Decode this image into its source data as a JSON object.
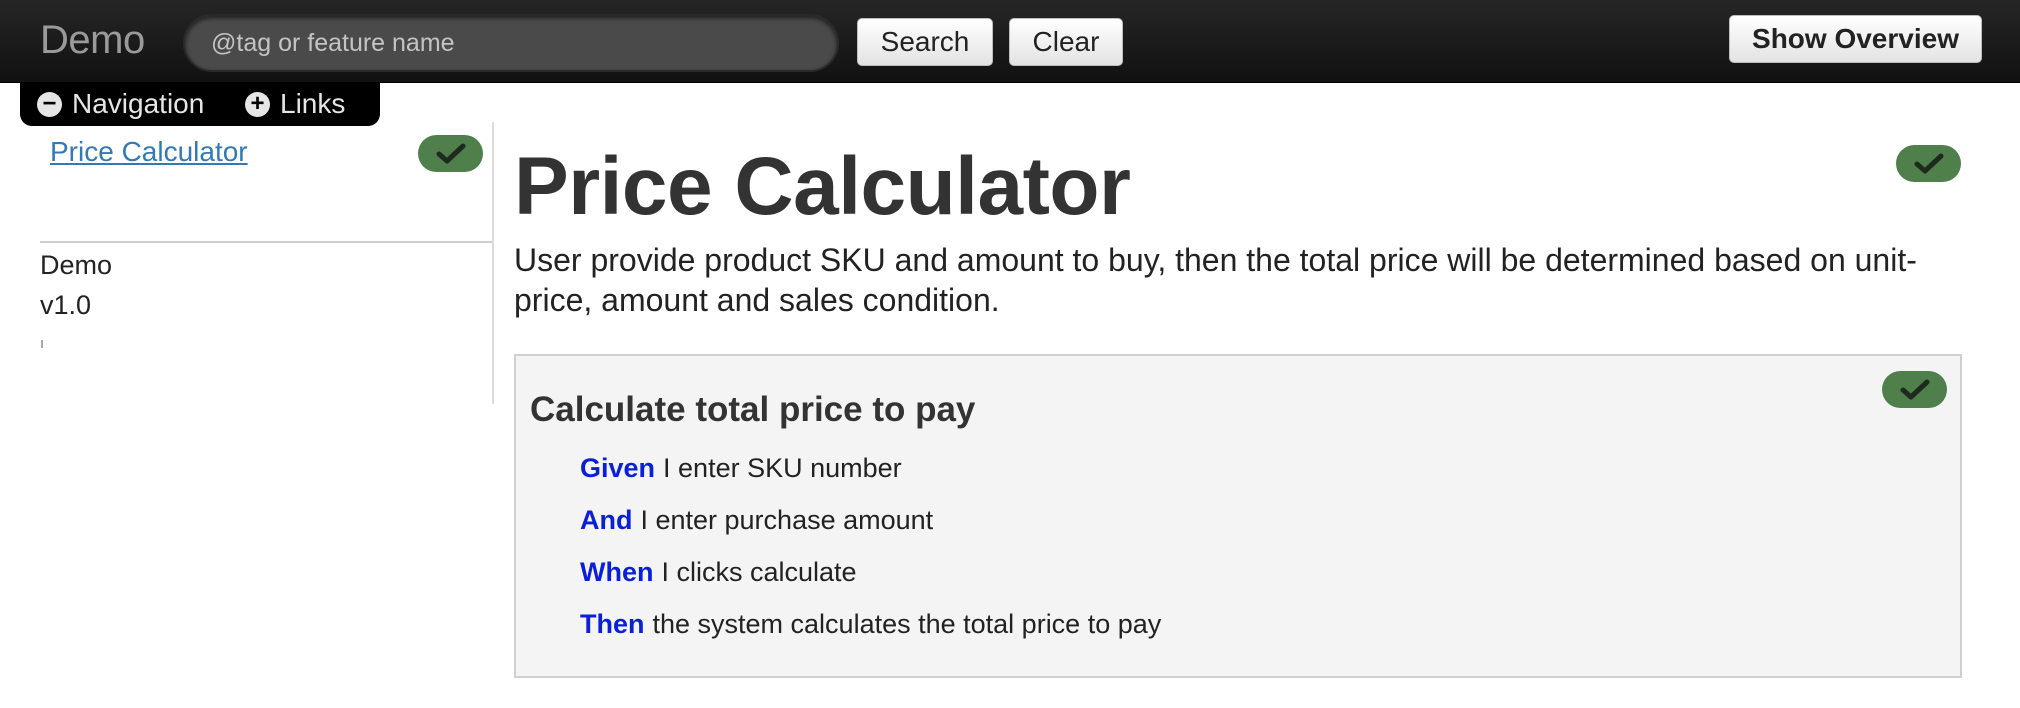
{
  "navbar": {
    "brand": "Demo",
    "search_placeholder": "@tag or feature name",
    "search_button": "Search",
    "clear_button": "Clear",
    "overview_button": "Show Overview"
  },
  "tabs": {
    "navigation": {
      "symbol": "−",
      "label": "Navigation"
    },
    "links": {
      "symbol": "+",
      "label": "Links"
    }
  },
  "sidebar": {
    "feature_link": "Price Calculator",
    "project": "Demo",
    "version": "v1.0"
  },
  "feature": {
    "title": "Price Calculator",
    "description": "User provide product SKU and amount to buy, then the total price will be determined based on unit-price, amount and sales condition.",
    "status_color": "#4f7f4a"
  },
  "scenario": {
    "title": "Calculate total price to pay",
    "steps": [
      {
        "keyword": "Given",
        "text": "I enter SKU number"
      },
      {
        "keyword": "And",
        "text": "I enter purchase amount"
      },
      {
        "keyword": "When",
        "text": "I clicks calculate"
      },
      {
        "keyword": "Then",
        "text": "the system calculates the total price to pay"
      }
    ]
  }
}
